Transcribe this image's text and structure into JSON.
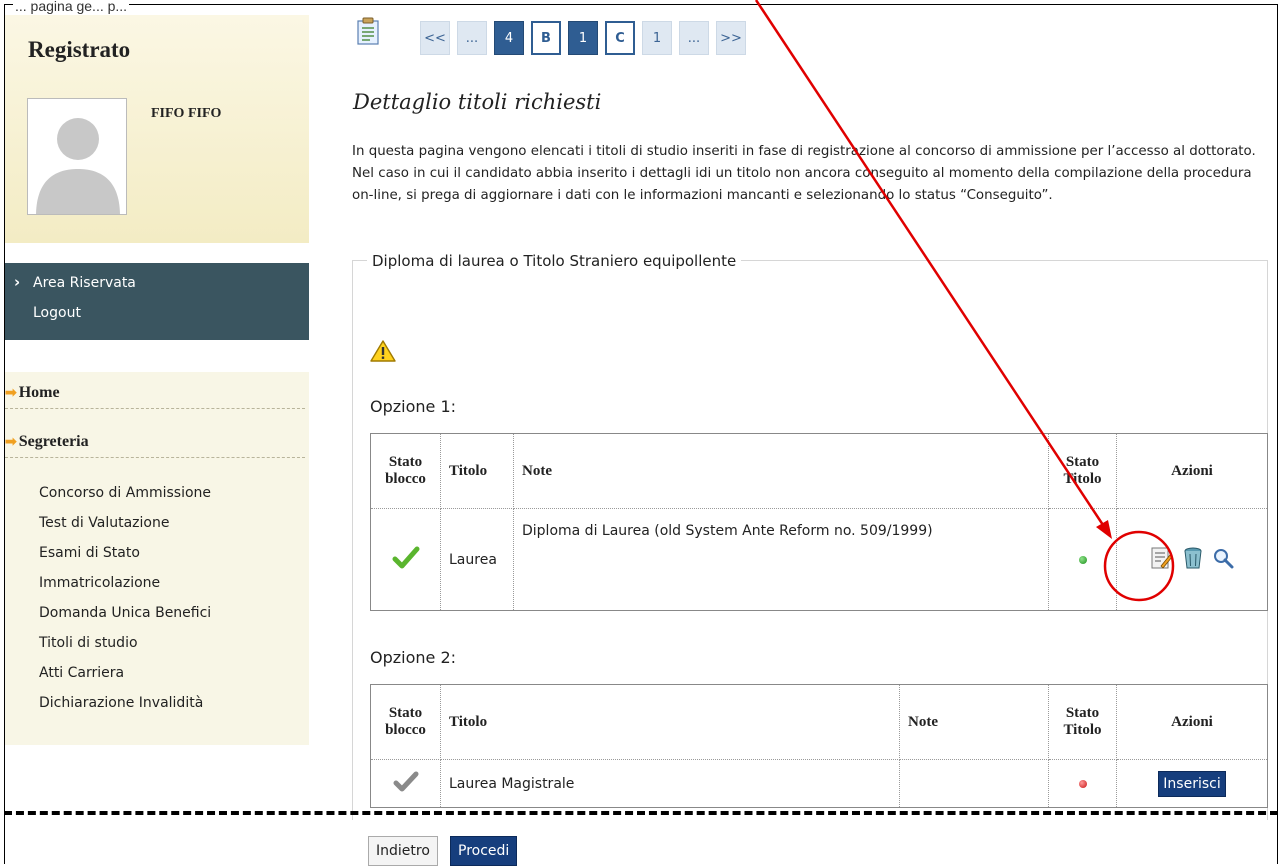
{
  "caption": "... pagina ge... p...",
  "sidebar": {
    "title": "Registrato",
    "user_name": "FIFO FIFO",
    "area_items": [
      "Area Riservata",
      "Logout"
    ],
    "sections": {
      "home": "Home",
      "segreteria": "Segreteria"
    },
    "links": [
      "Concorso di Ammissione",
      "Test di Valutazione",
      "Esami di Stato",
      "Immatricolazione",
      "Domanda Unica Benefici",
      "Titoli di studio",
      "Atti Carriera",
      "Dichiarazione Invalidità"
    ]
  },
  "pager": [
    "<<",
    "...",
    "4",
    "B",
    "1",
    "C",
    "1",
    "...",
    ">>"
  ],
  "main": {
    "title": "Dettaglio titoli richiesti",
    "intro": "In questa pagina vengono elencati i titoli di studio inseriti in fase di registrazione al concorso di ammissione per l’accesso al dottorato. Nel caso in cui il candidato abbia inserito i dettagli idi un titolo non ancora conseguito al momento della compilazione della procedura on-line, si prega di aggiornare i dati con le informazioni mancanti e selezionando lo status “Conseguito”.",
    "fieldset_legend": "Diploma di laurea o Titolo Straniero equipollente",
    "option1": {
      "title": "Opzione 1:",
      "headers": [
        "Stato blocco",
        "Titolo",
        "Note",
        "Stato Titolo",
        "Azioni"
      ],
      "row": {
        "titolo": "Laurea",
        "note": "Diploma di Laurea (old System Ante Reform no. 509/1999)"
      }
    },
    "option2": {
      "title": "Opzione 2:",
      "headers": [
        "Stato blocco",
        "Titolo",
        "Note",
        "Stato Titolo",
        "Azioni"
      ],
      "row": {
        "titolo": "Laurea Magistrale",
        "note": ""
      },
      "insert_label": "Inserisci"
    },
    "buttons": {
      "back": "Indietro",
      "proceed": "Procedi"
    }
  },
  "colors": {
    "nav_dark": "#3a5560",
    "accent_blue": "#163e7d",
    "annotation_red": "#e00000"
  }
}
